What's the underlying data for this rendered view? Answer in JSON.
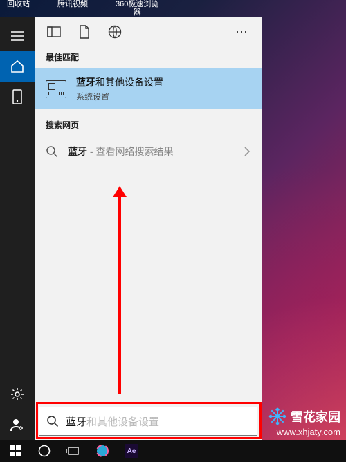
{
  "desktop_icons": [
    "回收站",
    "腾讯视频",
    "360极速浏览\n器"
  ],
  "sidebar": {
    "items": [
      "menu",
      "home",
      "device",
      "gear",
      "account"
    ]
  },
  "toolbar": {
    "more": "⋯"
  },
  "sections": {
    "best_match": "最佳匹配",
    "search_web": "搜索网页"
  },
  "best_hit": {
    "bold": "蓝牙",
    "rest": "和其他设备设置",
    "subtitle": "系统设置"
  },
  "web_result": {
    "bold": "蓝牙",
    "suffix": " - 查看网络搜索结果"
  },
  "search": {
    "typed": "蓝牙",
    "ghost": "和其他设备设置"
  },
  "watermark": {
    "brand": "雪花家园",
    "url": "www.xhjaty.com"
  },
  "colors": {
    "highlight": "#a7d3f2",
    "accent": "#0063b1",
    "arrow": "#ff0000"
  }
}
